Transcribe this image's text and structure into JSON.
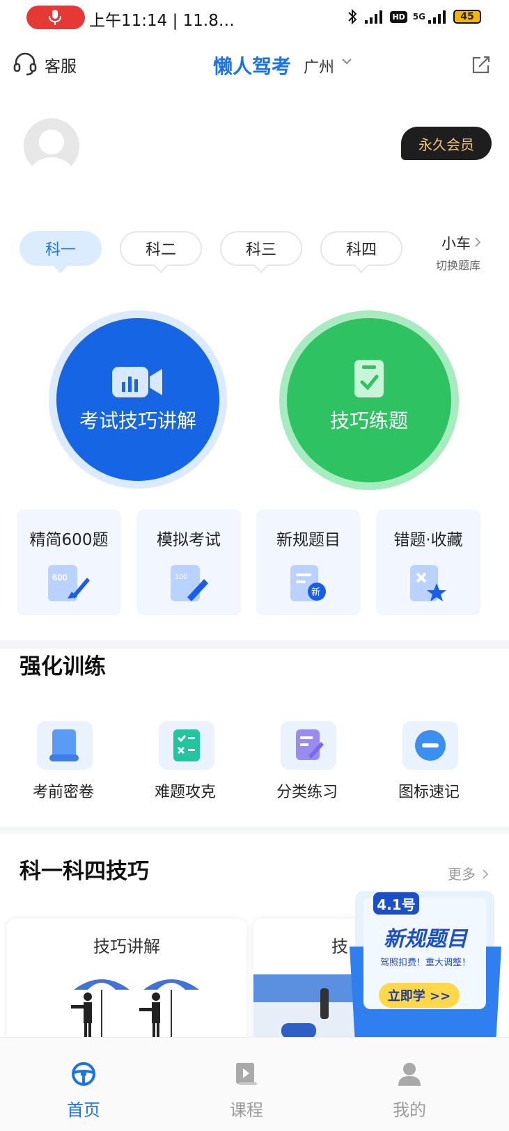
{
  "status_bar": {
    "time": "上午11:14 | 11.8…",
    "battery": "45",
    "network": "5G",
    "hd": "HD"
  },
  "header": {
    "service_label": "客服",
    "app_title": "懒人驾考",
    "city": "广州"
  },
  "profile": {
    "member_badge": "永久会员"
  },
  "subjects": {
    "tabs": [
      "科一",
      "科二",
      "科三",
      "科四"
    ],
    "active_index": 0,
    "car_type": "小车",
    "switch_label": "切换题库"
  },
  "main_actions": {
    "video": "考试技巧讲解",
    "practice": "技巧练题"
  },
  "practice_tiles": [
    {
      "label": "精简600题",
      "icon": "rocket-600-icon"
    },
    {
      "label": "模拟考试",
      "icon": "exam-pencil-icon"
    },
    {
      "label": "新规题目",
      "icon": "new-rule-icon"
    },
    {
      "label": "错题·收藏",
      "icon": "mistake-star-icon"
    }
  ],
  "training": {
    "title": "强化训练",
    "items": [
      {
        "label": "考前密卷",
        "icon": "scroll-icon"
      },
      {
        "label": "难题攻克",
        "icon": "checklist-icon"
      },
      {
        "label": "分类练习",
        "icon": "edit-note-icon"
      },
      {
        "label": "图标速记",
        "icon": "minus-circle-icon"
      }
    ]
  },
  "tips": {
    "title": "科一科四技巧",
    "more": "更多",
    "cards": [
      "技巧讲解",
      "技"
    ]
  },
  "promo": {
    "date_badge": "4.1号",
    "headline": "新规题目",
    "subtitle": "驾照扣费！重大调整！",
    "button": "立即学 >>"
  },
  "bottom_nav": [
    {
      "label": "首页",
      "icon": "steering-wheel-icon",
      "active": true
    },
    {
      "label": "课程",
      "icon": "play-book-icon",
      "active": false
    },
    {
      "label": "我的",
      "icon": "person-icon",
      "active": false
    }
  ],
  "colors": {
    "brand_blue": "#1565e4",
    "green": "#2ec262",
    "gold": "#f2c879"
  }
}
